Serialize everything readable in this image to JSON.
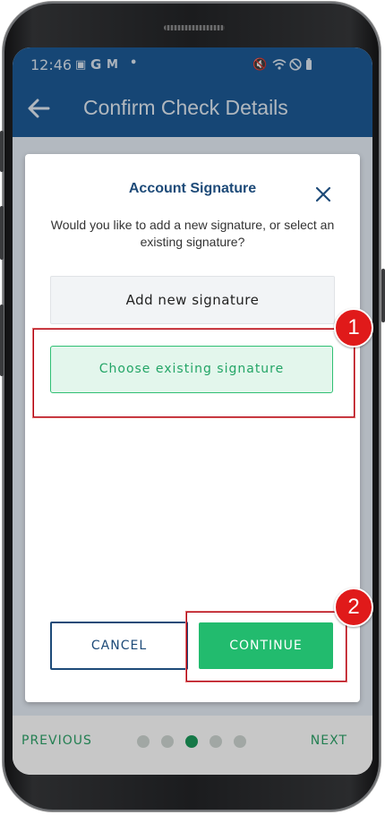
{
  "status_bar": {
    "time": "12:46",
    "left_icons": [
      "image-icon",
      "google-icon",
      "gmail-icon",
      "dot-icon"
    ],
    "right_icons": [
      "mute-icon",
      "wifi-icon",
      "do-not-disturb-icon",
      "battery-icon"
    ]
  },
  "app_bar": {
    "back_icon": "arrow-left-icon",
    "title": "Confirm Check Details"
  },
  "modal": {
    "title": "Account Signature",
    "close_icon": "close-icon",
    "message": "Would you like to add a new signature, or select an existing signature?",
    "add_new_label": "Add new signature",
    "choose_existing_label": "Choose existing signature",
    "cancel_label": "CANCEL",
    "continue_label": "CONTINUE"
  },
  "bottom_nav": {
    "previous_label": "PREVIOUS",
    "next_label": "NEXT",
    "step_count": 5,
    "active_step": 3
  },
  "annotations": [
    {
      "number": "1"
    },
    {
      "number": "2"
    }
  ],
  "colors": {
    "primary_blue": "#1d5a96",
    "accent_green": "#22bb6e",
    "annotation_red": "#e01a1a"
  }
}
